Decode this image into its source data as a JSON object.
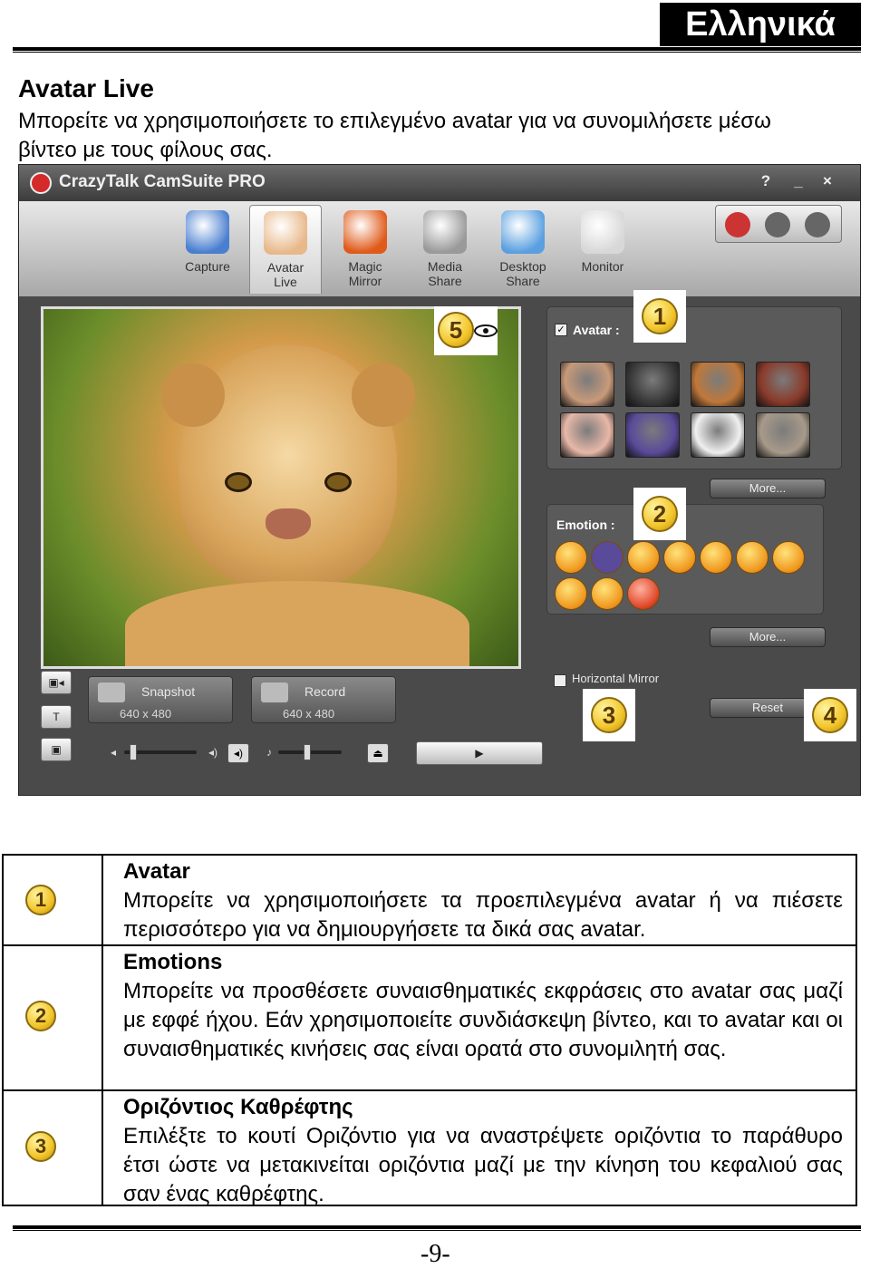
{
  "language_badge": "Ελληνικά",
  "section_title": "Avatar Live",
  "intro": "Μπορείτε να χρησιμοποιήσετε το επιλεγμένο avatar για να συνομιλήσετε μέσω βίντεο με τους φίλους σας.",
  "app": {
    "title": "CrazyTalk CamSuite PRO",
    "window_buttons": [
      "?",
      "_",
      "×"
    ],
    "tools": [
      {
        "label": "Capture",
        "icon": "webcam-icon",
        "color": "#4a7fd0"
      },
      {
        "label": "Avatar\nLive",
        "icon": "baby-face-icon",
        "color": "#e8b88a"
      },
      {
        "label": "Magic\nMirror",
        "icon": "mask-icon",
        "color": "#e05a1a"
      },
      {
        "label": "Media\nShare",
        "icon": "film-reel-icon",
        "color": "#9a9a9a"
      },
      {
        "label": "Desktop\nShare",
        "icon": "monitors-icon",
        "color": "#5aa0e0"
      },
      {
        "label": "Monitor",
        "icon": "security-camera-icon",
        "color": "#d8d8d8"
      }
    ],
    "controls": {
      "snapshot_label": "Snapshot",
      "snapshot_res": "640 x 480",
      "record_label": "Record",
      "record_res": "640 x 480"
    },
    "avatar_panel": {
      "title": "Avatar :",
      "thumb_colors": [
        "#c89a7a",
        "#3a3a3a",
        "#c0783a",
        "#8a3a2a",
        "#e8b8a8",
        "#5a4a9a",
        "#f0f0f0",
        "#a89a8a"
      ],
      "more_label": "More..."
    },
    "emotion_panel": {
      "title": "Emotion :",
      "count": 10,
      "more_label": "More..."
    },
    "horizontal_mirror_label": "Horizontal Mirror",
    "reset_label": "Reset",
    "callouts": [
      "1",
      "2",
      "3",
      "4",
      "5"
    ]
  },
  "table": {
    "rows": [
      {
        "num": "1",
        "title": "Avatar",
        "body": "Μπορείτε να χρησιμοποιήσετε τα προεπιλεγμένα avatar ή να πιέσετε περισσότερο για να δημιουργήσετε τα δικά σας avatar."
      },
      {
        "num": "2",
        "title": "Emotions",
        "body": "Μπορείτε να προσθέσετε συναισθηματικές εκφράσεις στο avatar σας μαζί με εφφέ ήχου. Εάν χρησιμοποιείτε συνδιάσκεψη βίντεο, και το avatar και οι συναισθηματικές κινήσεις σας είναι ορατά στο συνομιλητή σας."
      },
      {
        "num": "3",
        "title": "Οριζόντιος Καθρέφτης",
        "body": "Επιλέξτε το κουτί Οριζόντιο για να αναστρέψετε οριζόντια το παράθυρο έτσι ώστε να μετακινείται οριζόντια μαζί με την κίνηση του κεφαλιού σας σαν ένας καθρέφτης."
      }
    ]
  },
  "page_number": "-9-"
}
